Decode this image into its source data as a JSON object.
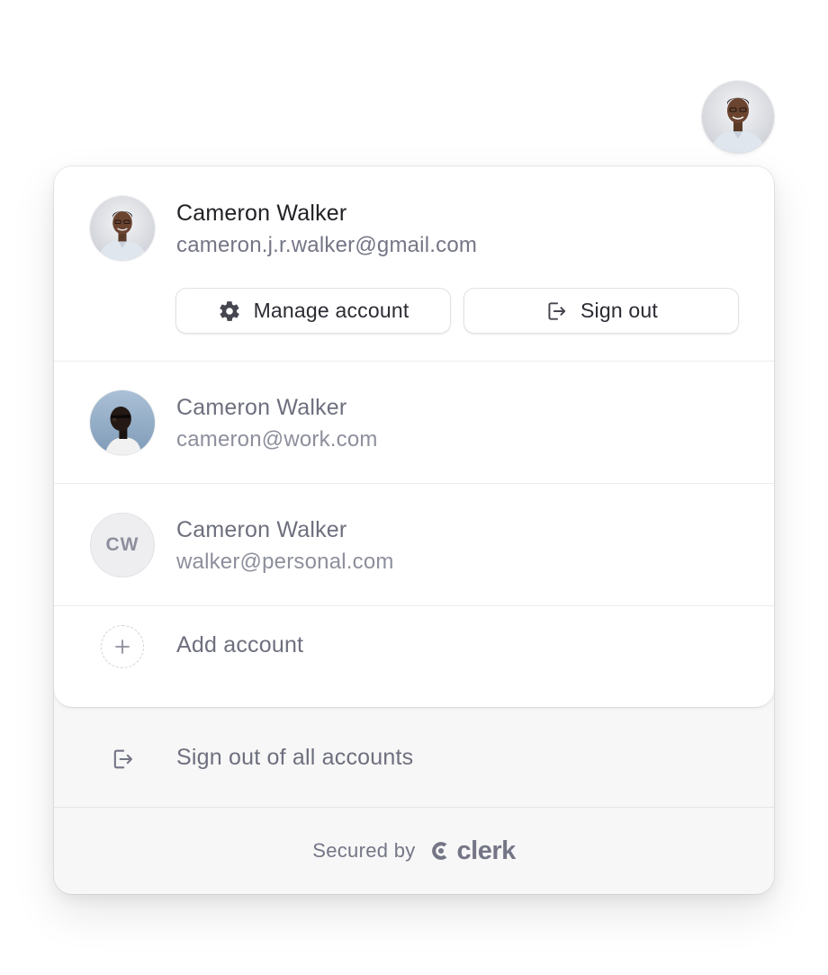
{
  "active_account": {
    "name": "Cameron Walker",
    "email": "cameron.j.r.walker@gmail.com",
    "manage_label": "Manage account",
    "signout_label": "Sign out"
  },
  "other_accounts": [
    {
      "name": "Cameron Walker",
      "email": "cameron@work.com",
      "avatar": "photo"
    },
    {
      "name": "Cameron Walker",
      "email": "walker@personal.com",
      "avatar": "initials",
      "initials": "CW"
    }
  ],
  "add_account_label": "Add account",
  "signout_all_label": "Sign out of all accounts",
  "footer": {
    "secured_by": "Secured by",
    "brand": "clerk"
  },
  "icons": {
    "manage": "gear-icon",
    "signout": "sign-out-icon",
    "add": "plus-icon",
    "brand": "clerk-logo-icon"
  },
  "colors": {
    "primary_text": "#212126",
    "secondary_text": "#747686",
    "footer_bg": "#f7f7f7",
    "border": "#e2e2e6"
  }
}
